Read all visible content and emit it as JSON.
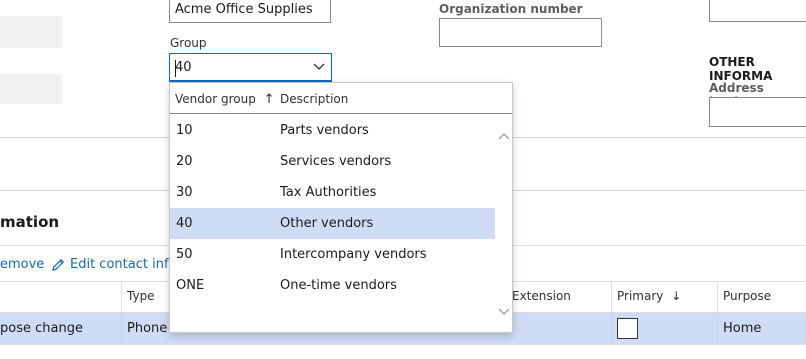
{
  "form": {
    "name_value": "Acme Office Supplies",
    "group_label": "Group",
    "group_value": "40",
    "org_number_label": "Organization number",
    "org_number_value": "",
    "other_info_heading": "OTHER INFORMA",
    "address_books_label": "Address books"
  },
  "dropdown": {
    "col_vendor_group": "Vendor group",
    "col_vendor_group_sort": "↑",
    "col_description": "Description",
    "rows": [
      {
        "code": "10",
        "description": "Parts vendors"
      },
      {
        "code": "20",
        "description": "Services vendors"
      },
      {
        "code": "30",
        "description": "Tax Authorities"
      },
      {
        "code": "40",
        "description": "Other vendors"
      },
      {
        "code": "50",
        "description": "Intercompany vendors"
      },
      {
        "code": "ONE",
        "description": "One-time vendors"
      }
    ],
    "selected_index": 3
  },
  "contact_section": {
    "heading": "mation",
    "remove_label": "emove",
    "edit_label": "Edit contact info"
  },
  "grid": {
    "columns": {
      "type": "Type",
      "extension": "Extension",
      "primary": "Primary",
      "primary_sort": "↓",
      "purpose": "Purpose"
    },
    "row": {
      "description": "pose change",
      "type": "Phone",
      "purpose": "Home"
    }
  },
  "colors": {
    "accent": "#0f6cbd",
    "selected_row": "#cfdcf5"
  }
}
